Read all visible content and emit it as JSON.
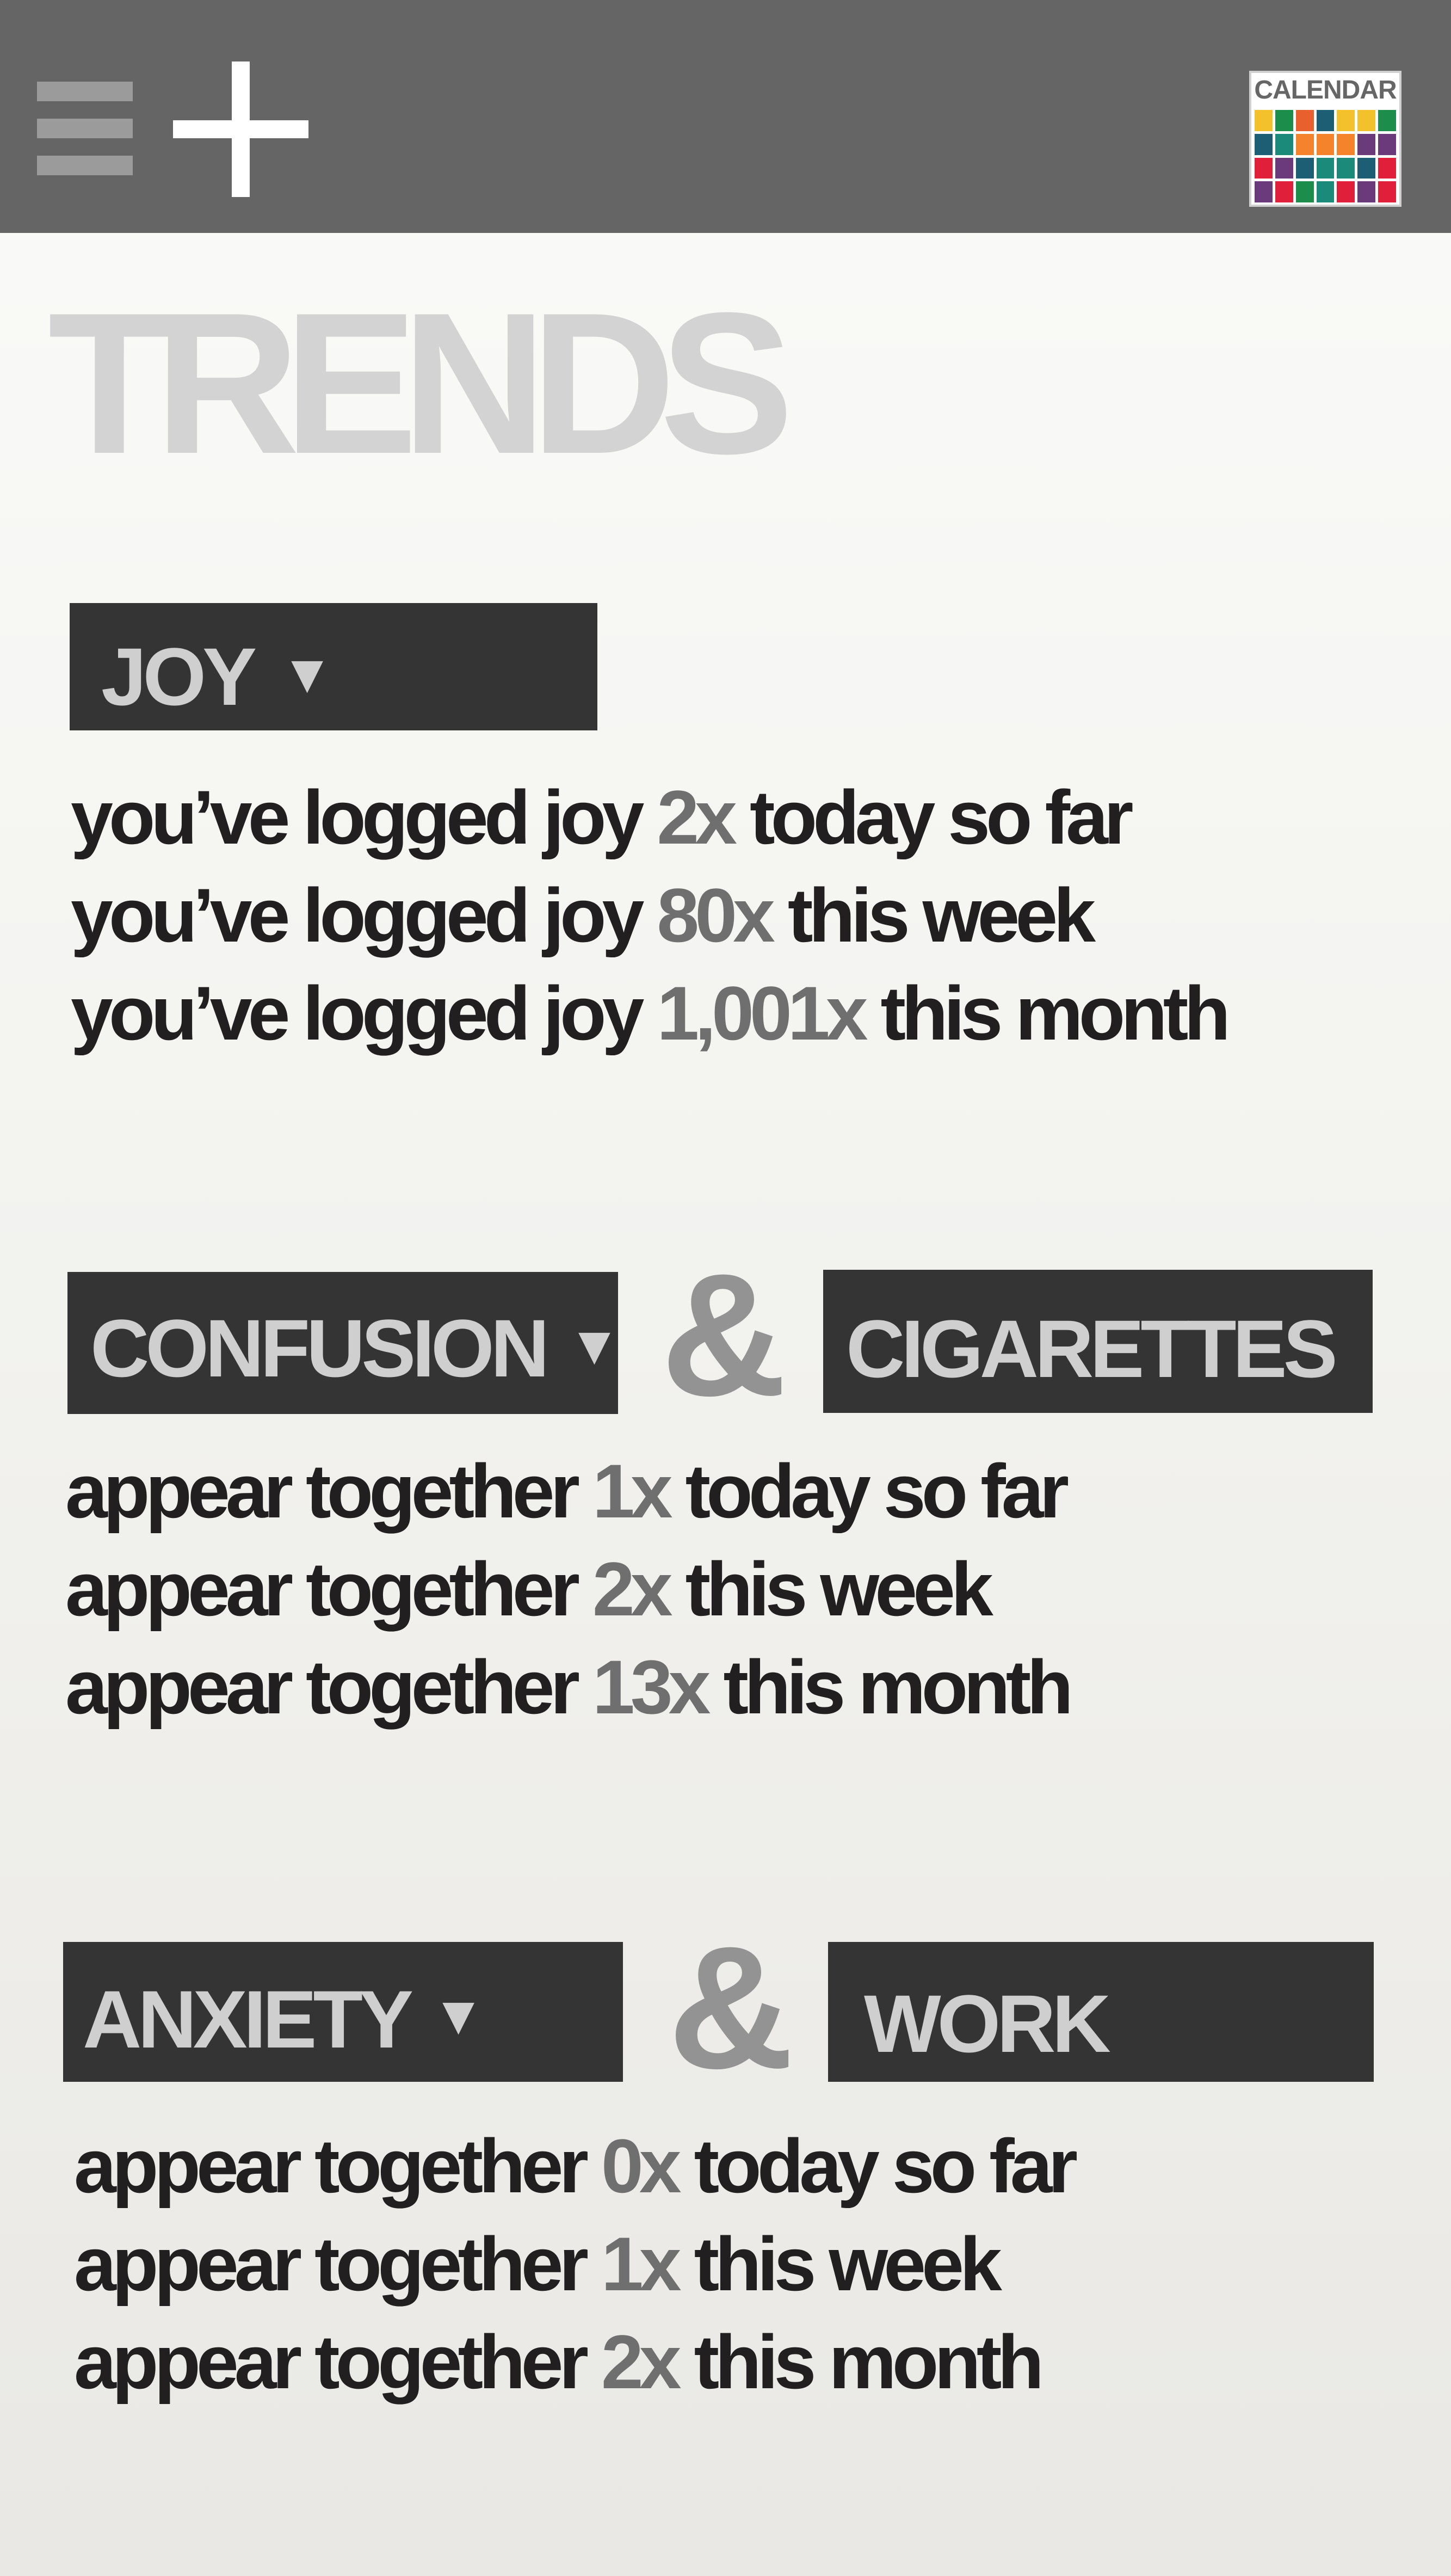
{
  "header": {
    "calendar_label": "CALENDAR",
    "calendar_colors": [
      "#f3c12b",
      "#1c8d4a",
      "#e8602e",
      "#1d5e74",
      "#f3c12b",
      "#f3c12b",
      "#1c8d4a",
      "#1d5e74",
      "#1b8a7a",
      "#f4832b",
      "#f4832b",
      "#f4832b",
      "#6b3a7a",
      "#6b3a7a",
      "#e0203a",
      "#6b3a7a",
      "#1d5e74",
      "#1b8a7a",
      "#1b8a7a",
      "#1d5e74",
      "#e0203a",
      "#6b3a7a",
      "#e0203a",
      "#1c8d4a",
      "#1b8a7a",
      "#e0203a",
      "#6b3a7a",
      "#e0203a"
    ]
  },
  "page": {
    "title": "TRENDS"
  },
  "joy": {
    "tag": "JOY",
    "dropdown_icon": "▼",
    "lines": [
      {
        "prefix": "you’ve logged joy",
        "count": "2x",
        "suffix": "today so far"
      },
      {
        "prefix": "you’ve logged joy",
        "count": "80x",
        "suffix": "this week"
      },
      {
        "prefix": "you’ve logged joy",
        "count": "1,001x",
        "suffix": "this month"
      }
    ]
  },
  "pair1": {
    "tag_a": "CONFUSION",
    "dropdown_icon": "▼",
    "ampersand": "&",
    "tag_b": "CIGARETTES",
    "lines": [
      {
        "prefix": "appear together",
        "count": "1x",
        "suffix": "today so far"
      },
      {
        "prefix": "appear together",
        "count": "2x",
        "suffix": "this week"
      },
      {
        "prefix": "appear together",
        "count": "13x",
        "suffix": "this month"
      }
    ]
  },
  "pair2": {
    "tag_a": "ANXIETY",
    "dropdown_icon": "▼",
    "ampersand": "&",
    "tag_b": "WORK",
    "lines": [
      {
        "prefix": "appear together",
        "count": "0x",
        "suffix": "today so far"
      },
      {
        "prefix": "appear together",
        "count": "1x",
        "suffix": "this week"
      },
      {
        "prefix": "appear together",
        "count": "2x",
        "suffix": "this month"
      }
    ]
  }
}
